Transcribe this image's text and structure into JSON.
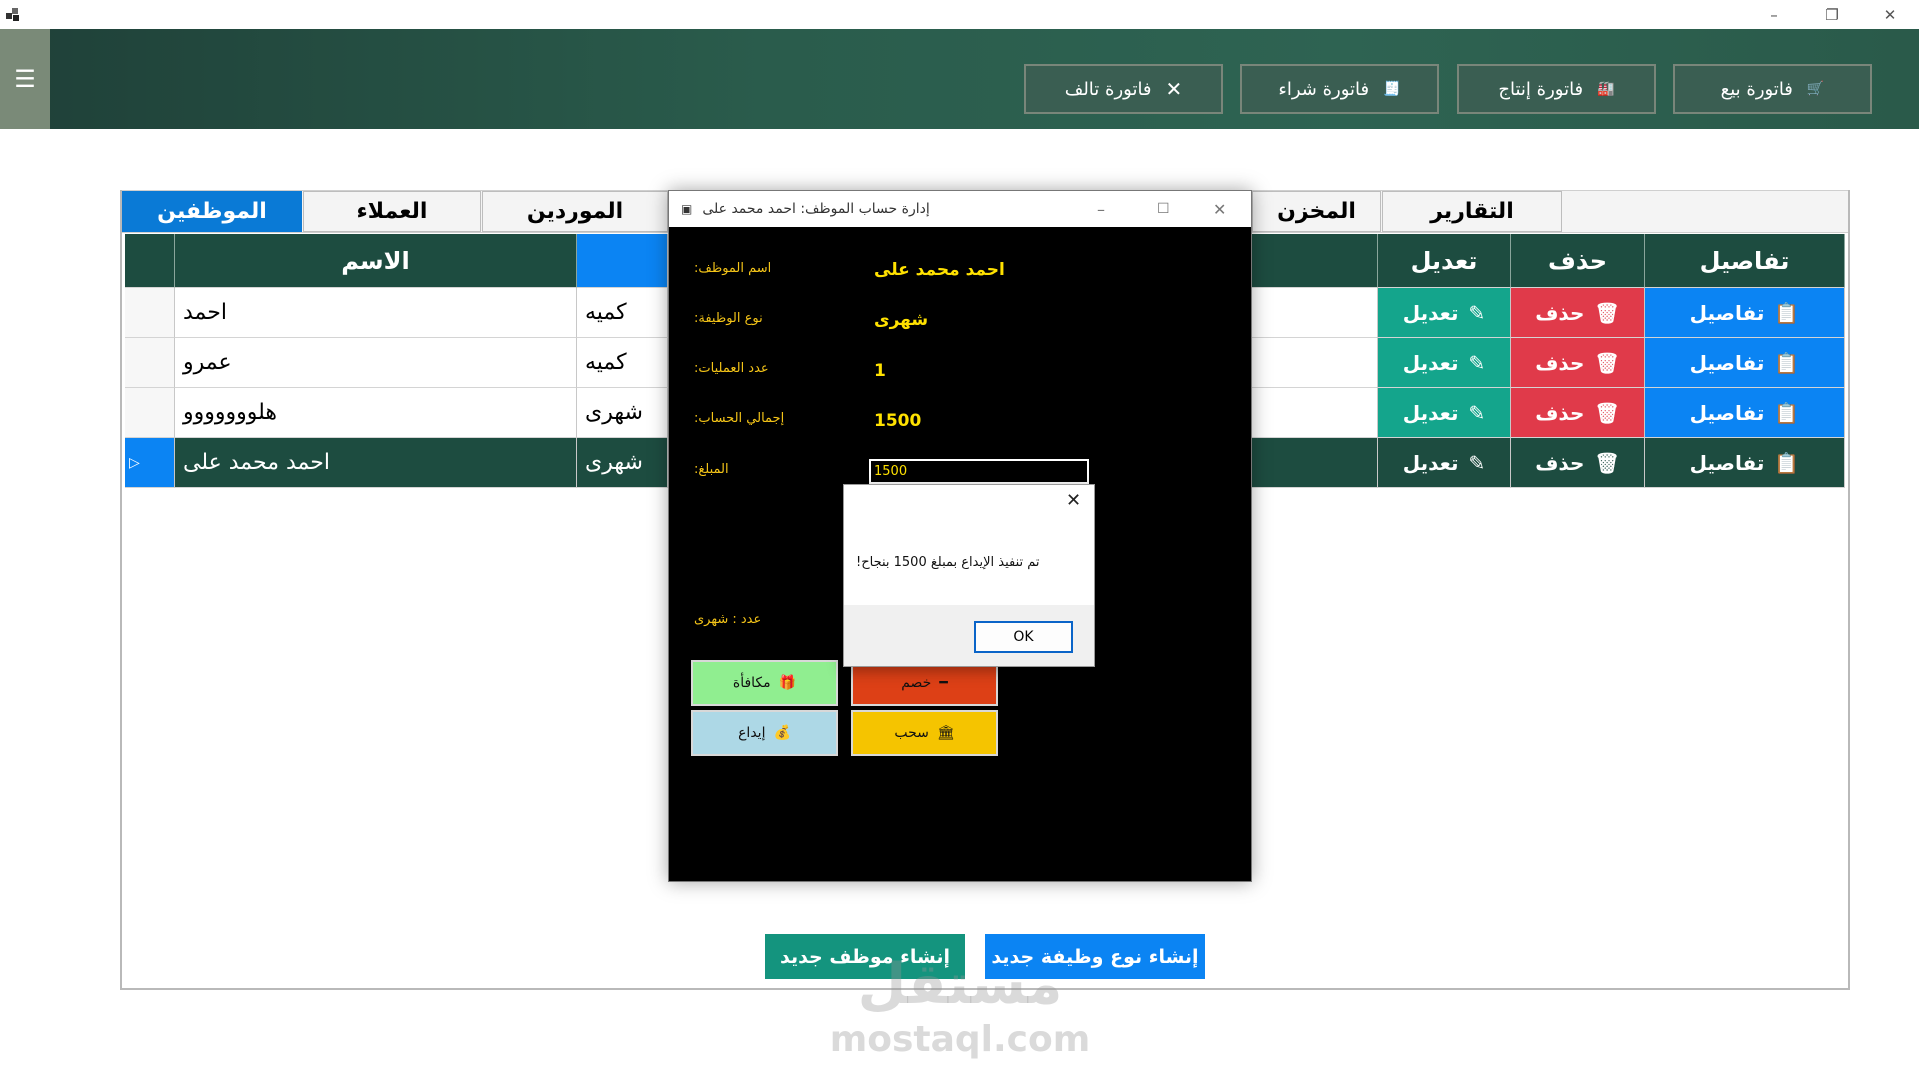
{
  "window": {
    "controls": [
      "–",
      "❐",
      "✕"
    ]
  },
  "header": {
    "menu_icon": "☰",
    "buttons": [
      {
        "label": "فاتورة بيع",
        "icon": "🛒"
      },
      {
        "label": "فاتورة إنتاج",
        "icon": "🏭"
      },
      {
        "label": "فاتورة شراء",
        "icon": "🧾"
      },
      {
        "label": "فاتورة تالف",
        "icon": "✕"
      }
    ]
  },
  "tabs": [
    "الموظفين",
    "العملاء",
    "الموردين",
    "المخزن",
    "التقارير"
  ],
  "grid": {
    "headers": {
      "name": "الاسم",
      "edit": "تعديل",
      "delete": "حذف",
      "details": "تفاصيل"
    },
    "rows": [
      {
        "name": "احمد",
        "type": "كميه"
      },
      {
        "name": "عمرو",
        "type": "كميه"
      },
      {
        "name": "هلووووووو",
        "type": "شهرى"
      },
      {
        "name": "احمد محمد على",
        "type": "شهرى"
      }
    ],
    "row_selector": "▷",
    "actions": {
      "edit": "تعديل",
      "delete": "حذف",
      "details": "تفاصيل"
    },
    "colors": {
      "details": "#0b84f3",
      "delete": "#e03a4a",
      "edit": "#14a58c",
      "selected": "#1d4c40"
    }
  },
  "dialog": {
    "title": "إدارة حساب الموظف: احمد محمد على",
    "fields": [
      {
        "label": ":اسم الموظف",
        "value": "احمد محمد على"
      },
      {
        "label": ":نوع الوظيفة",
        "value": "شهرى"
      },
      {
        "label": ":عدد العمليات",
        "value": "1"
      },
      {
        "label": ":إجمالي الحساب",
        "value": "1500"
      }
    ],
    "amount_label": ":المبلغ",
    "amount_value": "1500",
    "count_label": "عدد : شهرى",
    "buttons": {
      "bonus": "مكافأة",
      "discount": "خصم",
      "deposit": "إيداع",
      "withdraw": "سحب"
    }
  },
  "message_box": {
    "text": "!تم تنفيذ الإيداع بمبلغ 1500 بنجاح",
    "ok": "OK"
  },
  "bottom": {
    "new_employee": "إنشاء موظف جديد",
    "new_job_type": "إنشاء نوع وظيفة جديد"
  },
  "watermark": {
    "arabic": "مستقل",
    "latin": "mostaql.com"
  }
}
